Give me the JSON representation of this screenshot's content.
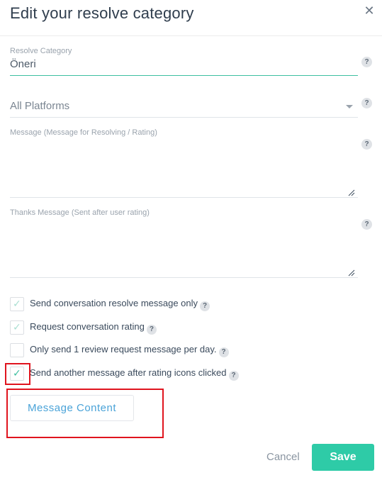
{
  "dialog": {
    "title": "Edit your resolve category",
    "close_icon": "close-icon"
  },
  "resolve_category": {
    "label": "Resolve Category",
    "value": "Öneri",
    "help": "?"
  },
  "platform": {
    "value": "All Platforms",
    "help": "?"
  },
  "message": {
    "placeholder": "Message (Message for Resolving / Rating)",
    "help": "?"
  },
  "thanks_message": {
    "placeholder": "Thanks Message (Sent after user rating)",
    "help": "?"
  },
  "options": [
    {
      "label": "Send conversation resolve message only",
      "checked": true,
      "help": "?"
    },
    {
      "label": "Request conversation rating",
      "checked": true,
      "help": "?"
    },
    {
      "label": "Only send 1 review request message per day.",
      "checked": false,
      "help": "?"
    },
    {
      "label": "Send another message after rating icons clicked",
      "checked": true,
      "help": "?"
    }
  ],
  "message_content_button": "Message Content",
  "footer": {
    "cancel": "Cancel",
    "save": "Save"
  },
  "colors": {
    "accent": "#2ecba7",
    "link": "#4aa3d8",
    "highlight": "#e0141e"
  }
}
